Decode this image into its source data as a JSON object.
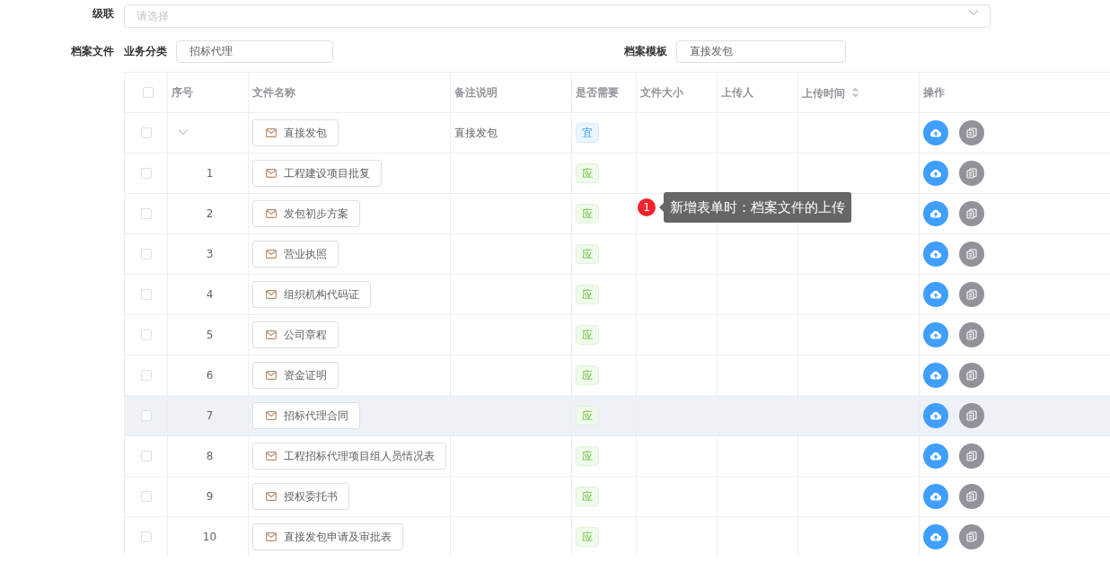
{
  "cascade": {
    "label": "级联",
    "placeholder": "请选择"
  },
  "archive": {
    "label": "档案文件",
    "category_label": "业务分类",
    "category_value": "招标代理",
    "template_label": "档案模板",
    "template_value": "直接发包"
  },
  "table": {
    "header_checked": false,
    "columns": [
      {
        "label": "序号",
        "sortable": false
      },
      {
        "label": "文件名称",
        "sortable": false
      },
      {
        "label": "备注说明",
        "sortable": false
      },
      {
        "label": "是否需要",
        "sortable": false
      },
      {
        "label": "文件大小",
        "sortable": false
      },
      {
        "label": "上传人",
        "sortable": false
      },
      {
        "label": "上传时间",
        "sortable": true
      },
      {
        "label": "操作",
        "sortable": false
      }
    ],
    "rows": [
      {
        "kind": "group",
        "expanded": true,
        "checked": false,
        "hovered": false,
        "name": "直接发包",
        "remark": "直接发包",
        "need": {
          "kind": "info",
          "label": "宜"
        }
      },
      {
        "kind": "item",
        "index": "1",
        "checked": false,
        "hovered": false,
        "name": "工程建设项目批复",
        "need": {
          "kind": "success",
          "label": "应"
        }
      },
      {
        "kind": "item",
        "index": "2",
        "checked": false,
        "hovered": false,
        "name": "发包初步方案",
        "need": {
          "kind": "success",
          "label": "应"
        }
      },
      {
        "kind": "item",
        "index": "3",
        "checked": false,
        "hovered": false,
        "name": "营业执照",
        "need": {
          "kind": "success",
          "label": "应"
        }
      },
      {
        "kind": "item",
        "index": "4",
        "checked": false,
        "hovered": false,
        "name": "组织机构代码证",
        "need": {
          "kind": "success",
          "label": "应"
        }
      },
      {
        "kind": "item",
        "index": "5",
        "checked": false,
        "hovered": false,
        "name": "公司章程",
        "need": {
          "kind": "success",
          "label": "应"
        }
      },
      {
        "kind": "item",
        "index": "6",
        "checked": false,
        "hovered": false,
        "name": "资金证明",
        "need": {
          "kind": "success",
          "label": "应"
        }
      },
      {
        "kind": "item",
        "index": "7",
        "checked": false,
        "hovered": true,
        "name": "招标代理合同",
        "need": {
          "kind": "success",
          "label": "应"
        }
      },
      {
        "kind": "item",
        "index": "8",
        "checked": false,
        "hovered": false,
        "name": "工程招标代理项目组人员情况表",
        "need": {
          "kind": "success",
          "label": "应"
        }
      },
      {
        "kind": "item",
        "index": "9",
        "checked": false,
        "hovered": false,
        "name": "授权委托书",
        "need": {
          "kind": "success",
          "label": "应"
        }
      },
      {
        "kind": "item",
        "index": "10",
        "checked": false,
        "hovered": false,
        "name": "直接发包申请及审批表",
        "need": {
          "kind": "success",
          "label": "应"
        }
      }
    ]
  },
  "tooltip": {
    "badge": "1",
    "text": "新增表单时：档案文件的上传"
  }
}
